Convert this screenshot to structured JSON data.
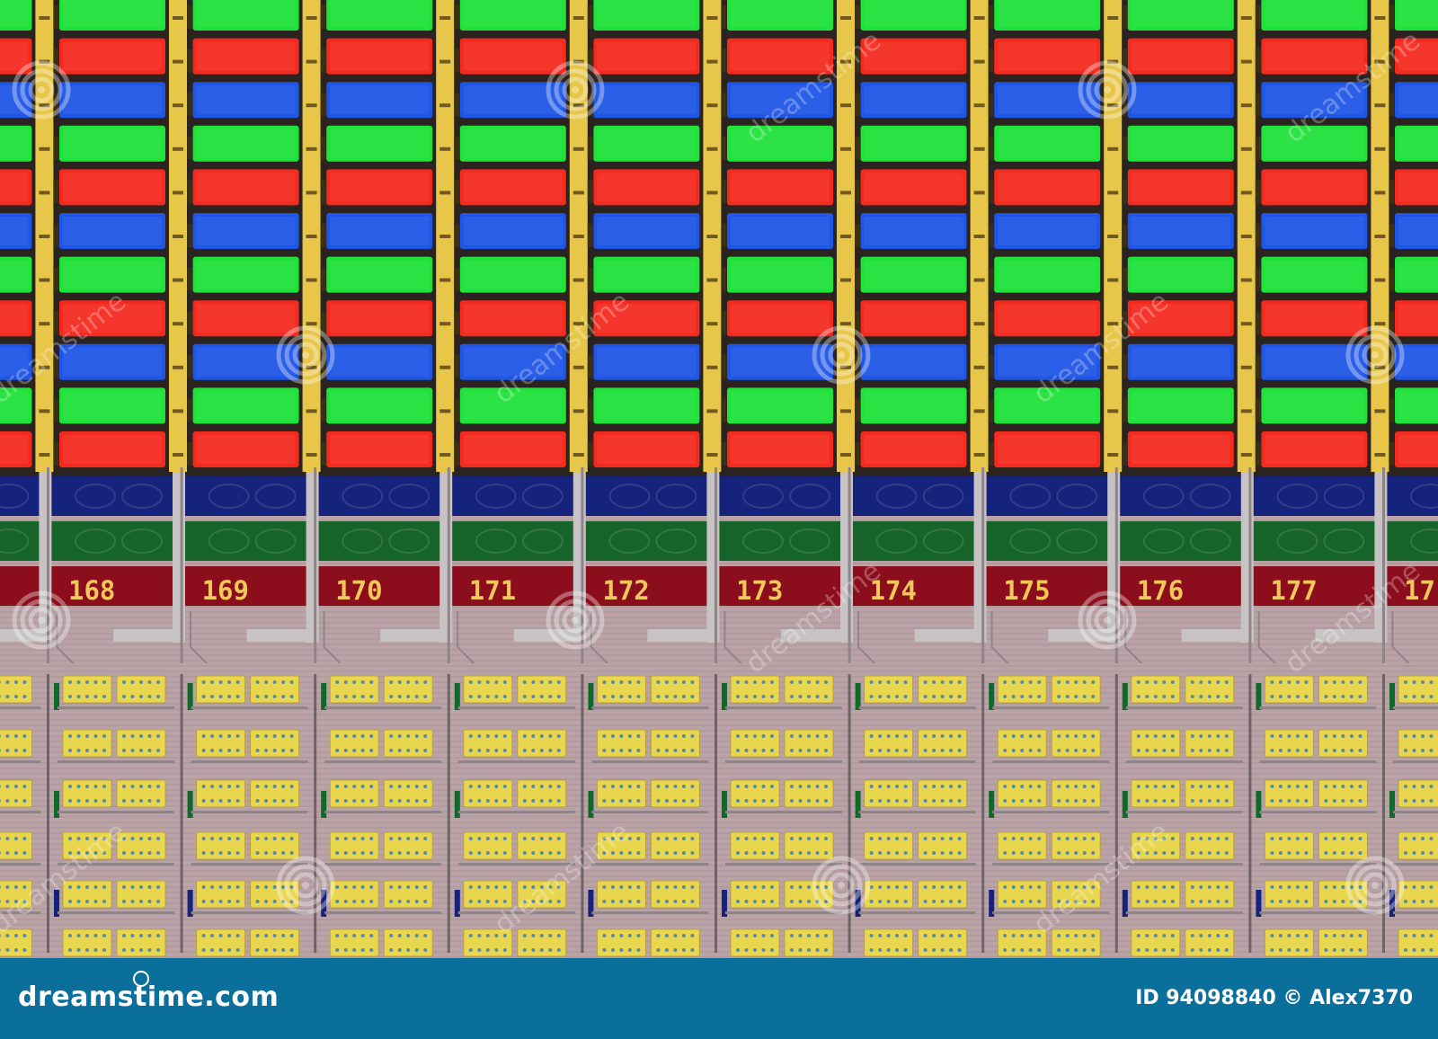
{
  "image": {
    "kind": "macro photograph of LCD subpixel grid and driver circuitry",
    "colors": {
      "green": "#1fe23a",
      "red": "#f52a1f",
      "blue": "#1f56e6",
      "gold_trace": "#e7c64a",
      "gate_line": "#c7c2c4",
      "dark_blue_row": "#16237c",
      "dark_green_row": "#17642b",
      "dark_red_row": "#8c0d1c",
      "substrate": "#b9a3a6",
      "pad_yellow": "#e9d64f",
      "footer_bg": "#0b6f9c"
    },
    "subpixel_row_pattern": [
      "green",
      "red",
      "blue"
    ],
    "subpixel_rows": 11,
    "columns": 11
  },
  "column_labels": [
    "168",
    "169",
    "170",
    "171",
    "172",
    "173",
    "174",
    "175",
    "176",
    "177",
    "17"
  ],
  "watermark": {
    "logo_icon": "spiral-watermark-icon",
    "text": "dreamstime"
  },
  "footer": {
    "brand": "dreamstime.com",
    "image_id": "ID 94098840",
    "author": "Alex7370",
    "credit": "ID 94098840 © Alex7370"
  }
}
